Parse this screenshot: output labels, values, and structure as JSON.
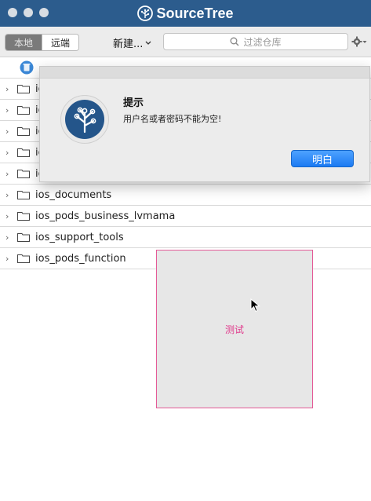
{
  "window": {
    "title": "SourceTree"
  },
  "toolbar": {
    "segments": [
      "本地",
      "远端"
    ],
    "new_label": "新建...",
    "search_placeholder": "过滤仓库"
  },
  "repos": [
    {
      "label": "io"
    },
    {
      "label": "io"
    },
    {
      "label": "io"
    },
    {
      "label": "io"
    },
    {
      "label": "io"
    },
    {
      "label": "ios_documents"
    },
    {
      "label": "ios_pods_business_lvmama"
    },
    {
      "label": "ios_support_tools"
    },
    {
      "label": "ios_pods_function"
    }
  ],
  "dialog": {
    "title": "提示",
    "message": "用户名或者密码不能为空!",
    "ok_label": "明白"
  },
  "test_panel": {
    "label": "测试"
  },
  "colors": {
    "titlebar": "#2c5c8d",
    "accent_button": "#1b7af2",
    "test_border": "#e45a97",
    "test_text": "#e03a8c"
  }
}
